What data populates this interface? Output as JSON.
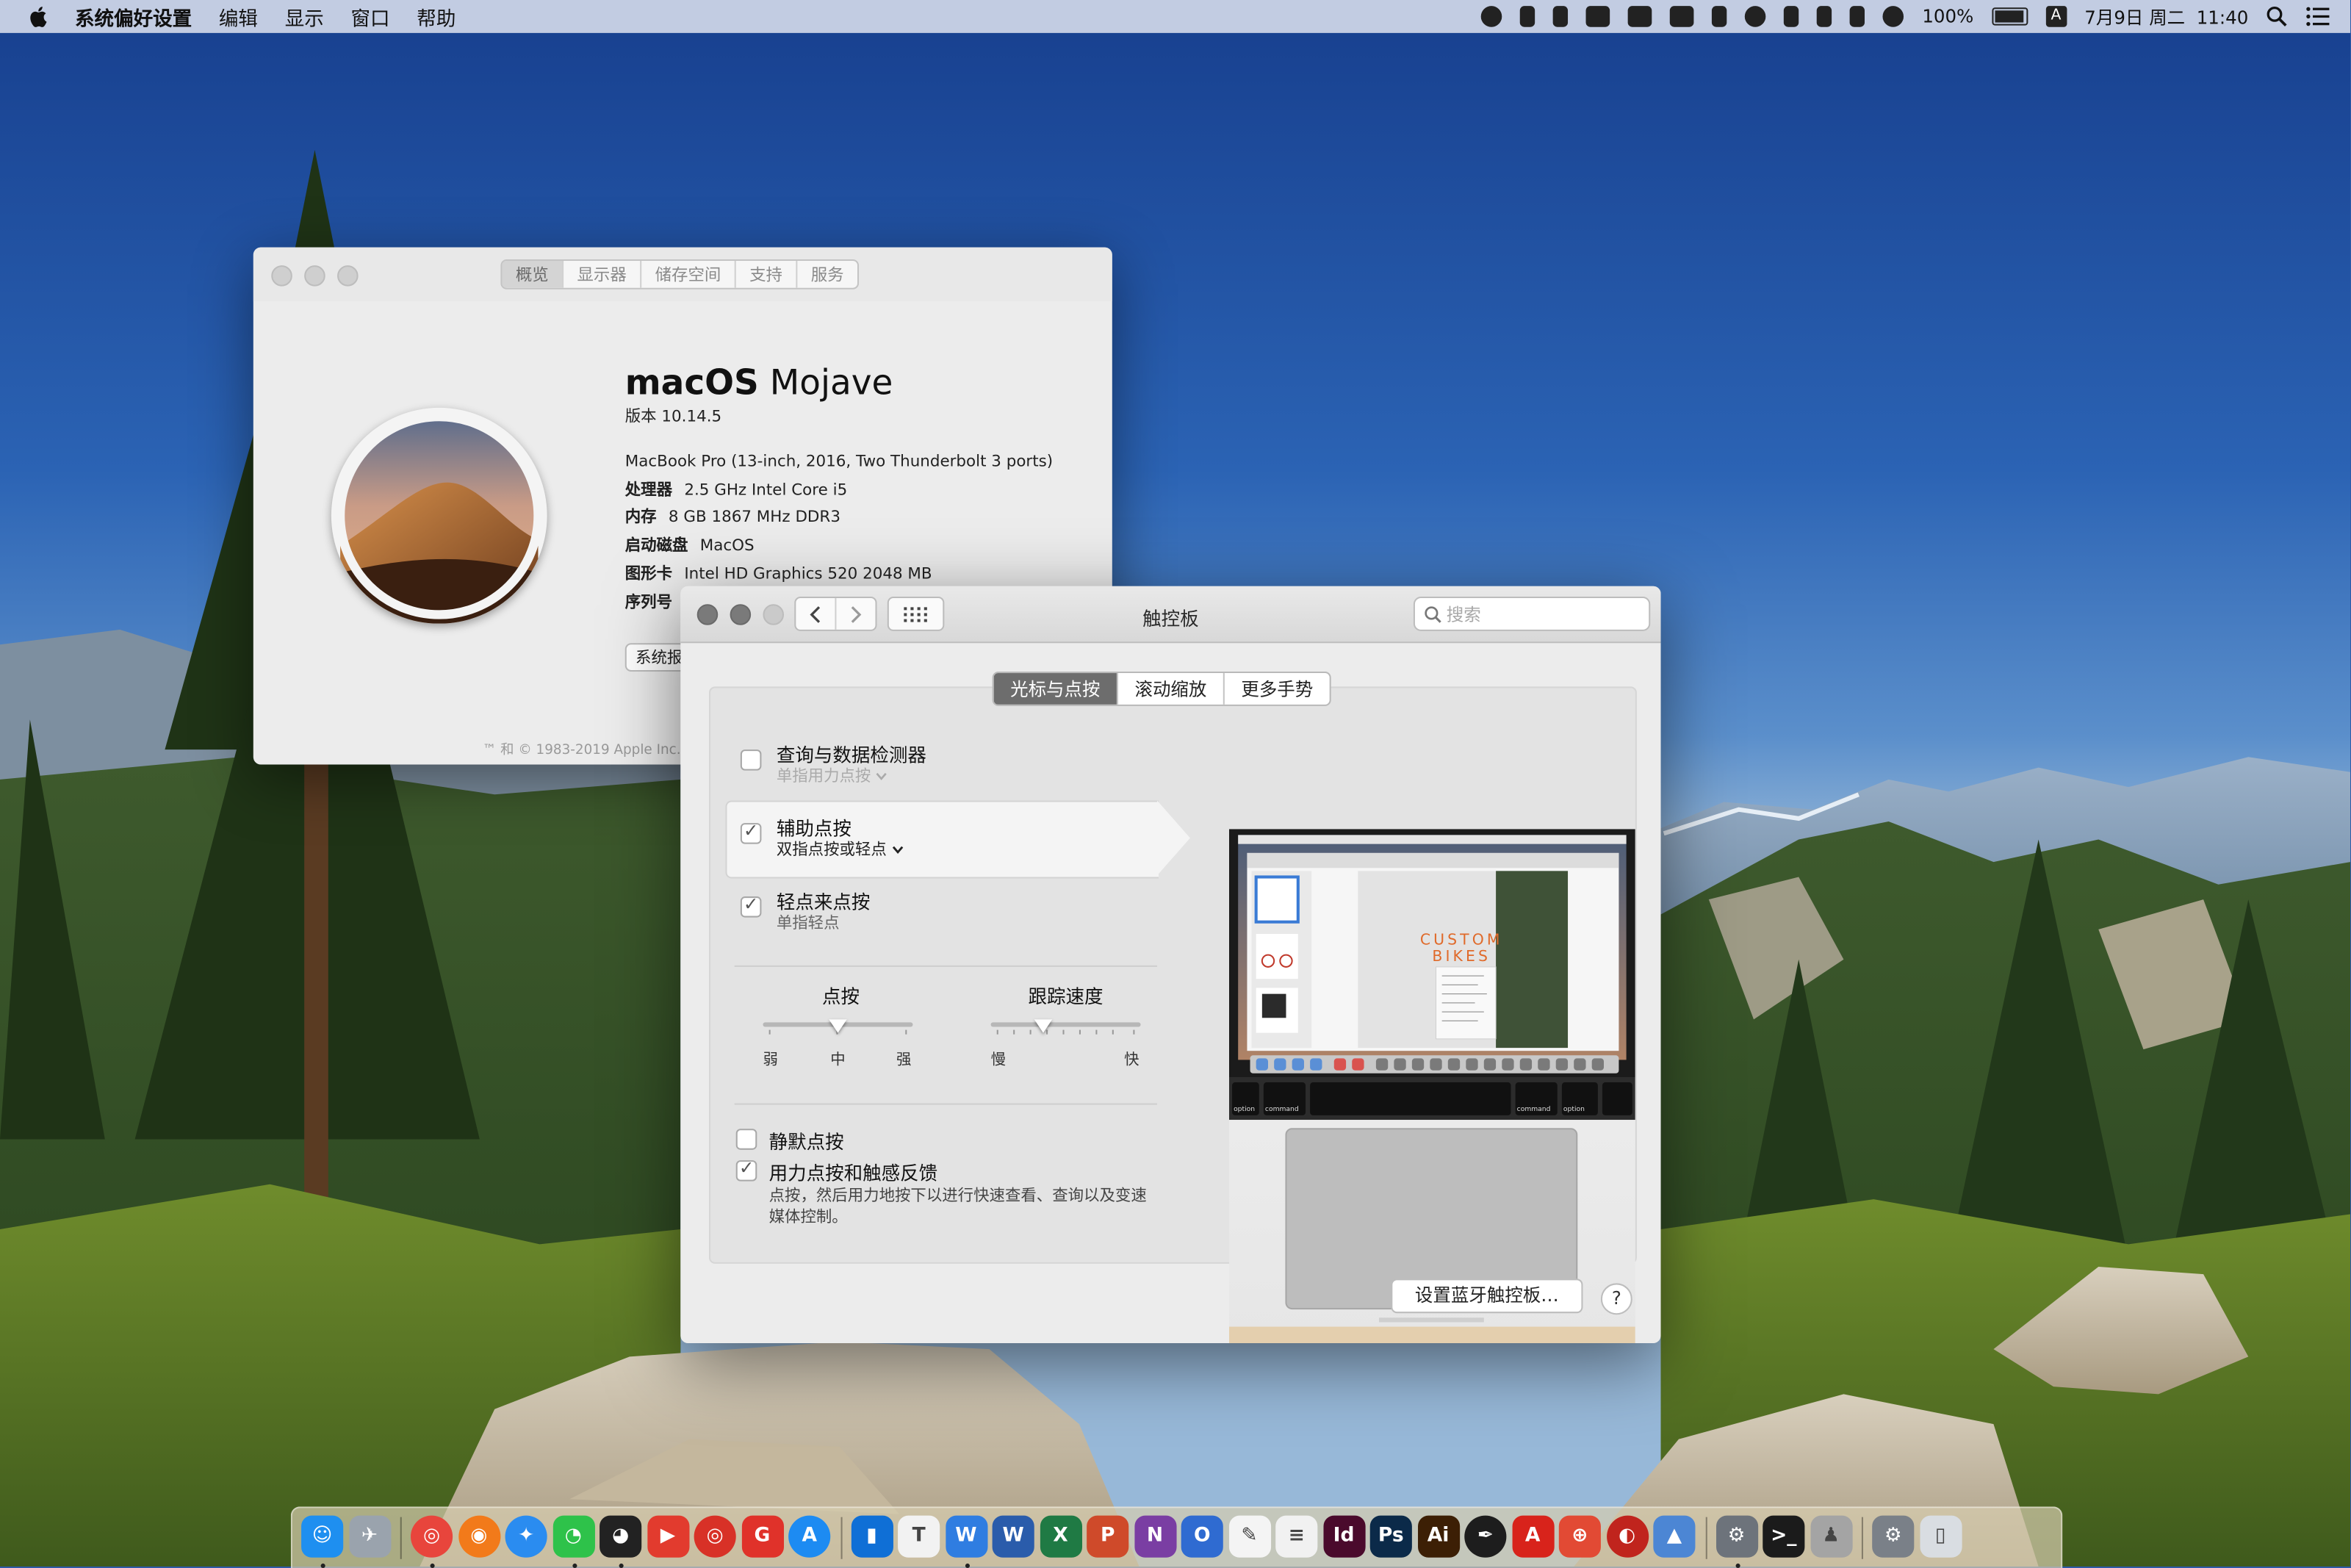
{
  "menubar": {
    "app_name": "系统偏好设置",
    "items": [
      "编辑",
      "显示",
      "窗口",
      "帮助"
    ],
    "battery": "100%",
    "input_method": "A",
    "clock": "7月9日 周二  11:40",
    "status_icons": [
      "wechat-icon",
      "signal-icon",
      "paw-icon",
      "bridge-icon",
      "send-icon",
      "cloud-icon",
      "grid-icon",
      "timemachine-icon",
      "network-icon",
      "eject-icon",
      "volume-icon",
      "vpn-icon"
    ]
  },
  "about": {
    "tabs": [
      "概览",
      "显示器",
      "储存空间",
      "支持",
      "服务"
    ],
    "active_tab": 0,
    "os_name_bold": "macOS",
    "os_name_rest": " Mojave",
    "version": "版本 10.14.5",
    "model": "MacBook Pro (13-inch, 2016, Two Thunderbolt 3 ports)",
    "specs": [
      {
        "key": "处理器",
        "value": "2.5 GHz Intel Core i5"
      },
      {
        "key": "内存",
        "value": "8 GB 1867 MHz DDR3"
      },
      {
        "key": "启动磁盘",
        "value": "MacOS"
      },
      {
        "key": "图形卡",
        "value": "Intel HD Graphics 520 2048 MB"
      },
      {
        "key": "序列号",
        "value": ""
      }
    ],
    "report_button": "系统报告...",
    "copyright": "™ 和 © 1983-2019 Apple Inc."
  },
  "trackpad": {
    "title": "触控板",
    "search_placeholder": "搜索",
    "tabs": [
      "光标与点按",
      "滚动缩放",
      "更多手势"
    ],
    "active_tab": 0,
    "options": [
      {
        "title": "查询与数据检测器",
        "subtitle": "单指用力点按",
        "checked": false,
        "dim": true
      },
      {
        "title": "辅助点按",
        "subtitle": "双指点按或轻点",
        "checked": true,
        "dim": false
      },
      {
        "title": "轻点来点按",
        "subtitle": "单指轻点",
        "checked": true,
        "dim": false
      }
    ],
    "click_slider": {
      "label": "点按",
      "min_label": "弱",
      "mid_label": "中",
      "max_label": "强",
      "value": 0.5
    },
    "speed_slider": {
      "label": "跟踪速度",
      "min_label": "慢",
      "max_label": "快",
      "value": 0.35
    },
    "silent_click": {
      "label": "静默点按",
      "checked": false
    },
    "force_click": {
      "label": "用力点按和触感反馈",
      "checked": true,
      "description": "点按，然后用力地按下以进行快速查看、查询以及变速媒体控制。"
    },
    "preview": {
      "poster_text_1": "CUSTOM",
      "poster_text_2": "BIKES",
      "key_left": "command",
      "key_right": "command",
      "key_option": "option"
    },
    "bluetooth_button": "设置蓝牙触控板…",
    "help_button": "?"
  },
  "dock": {
    "icons": [
      {
        "name": "finder",
        "glyph": "☺",
        "color": "#1e8ff0",
        "running": true
      },
      {
        "name": "launchpad",
        "glyph": "✈",
        "color": "#9aa3ad",
        "running": false
      },
      {
        "name": "sep1",
        "sep": true
      },
      {
        "name": "chrome",
        "glyph": "◎",
        "color": "#e8453c",
        "round": true,
        "running": true
      },
      {
        "name": "firefox",
        "glyph": "◉",
        "color": "#f27a1a",
        "round": true,
        "running": false
      },
      {
        "name": "safari",
        "glyph": "✦",
        "color": "#2a8cf0",
        "round": true,
        "running": false
      },
      {
        "name": "wechat",
        "glyph": "◔",
        "color": "#2ec24a",
        "running": true
      },
      {
        "name": "qq",
        "glyph": "◕",
        "color": "#222222",
        "running": true
      },
      {
        "name": "pdf-expert",
        "glyph": "▶",
        "color": "#e23b2e",
        "running": false
      },
      {
        "name": "netease-music",
        "glyph": "◎",
        "color": "#d83127",
        "round": true,
        "running": false
      },
      {
        "name": "gif-brewery",
        "glyph": "G",
        "color": "#e0322a",
        "running": false
      },
      {
        "name": "app-store",
        "glyph": "A",
        "color": "#1d8bf2",
        "round": true,
        "running": false
      },
      {
        "name": "sep2",
        "sep": true
      },
      {
        "name": "trello",
        "glyph": "▮",
        "color": "#0f6fd6",
        "running": false
      },
      {
        "name": "typora",
        "glyph": "T",
        "color": "#f2f2f2",
        "running": false
      },
      {
        "name": "wps",
        "glyph": "W",
        "color": "#2f7de1",
        "running": true
      },
      {
        "name": "word",
        "glyph": "W",
        "color": "#2a5cab",
        "running": false
      },
      {
        "name": "excel",
        "glyph": "X",
        "color": "#1f7a44",
        "running": false
      },
      {
        "name": "powerpoint",
        "glyph": "P",
        "color": "#cf4a2a",
        "running": false
      },
      {
        "name": "onenote",
        "glyph": "N",
        "color": "#7a3ea3",
        "running": false
      },
      {
        "name": "outlook",
        "glyph": "O",
        "color": "#2f6bd1",
        "running": false
      },
      {
        "name": "pages",
        "glyph": "✎",
        "color": "#f4f4f4",
        "running": false
      },
      {
        "name": "notes",
        "glyph": "≡",
        "color": "#f1f1f1",
        "running": false
      },
      {
        "name": "indesign",
        "glyph": "Id",
        "color": "#4a0a2c",
        "running": false
      },
      {
        "name": "photoshop",
        "glyph": "Ps",
        "color": "#0b2a49",
        "running": false
      },
      {
        "name": "illustrator",
        "glyph": "Ai",
        "color": "#3c1f05",
        "running": false
      },
      {
        "name": "inkscape",
        "glyph": "✒",
        "color": "#1d1d1d",
        "round": true,
        "running": false
      },
      {
        "name": "acrobat",
        "glyph": "A",
        "color": "#d8231b",
        "running": false
      },
      {
        "name": "pdf-reader",
        "glyph": "⊕",
        "color": "#e24a34",
        "running": false
      },
      {
        "name": "recorder",
        "glyph": "◐",
        "color": "#c0241d",
        "round": true,
        "running": false
      },
      {
        "name": "transmit",
        "glyph": "▲",
        "color": "#4c86d4",
        "running": false
      },
      {
        "name": "sep3",
        "sep": true
      },
      {
        "name": "system-preferences",
        "glyph": "⚙",
        "color": "#6d737b",
        "running": true
      },
      {
        "name": "terminal",
        "glyph": ">_",
        "color": "#1b1b1b",
        "running": false
      },
      {
        "name": "automator",
        "glyph": "♟",
        "color": "#a4a4a4",
        "running": false
      },
      {
        "name": "sep4",
        "sep": true
      },
      {
        "name": "system-prefs-2",
        "glyph": "⚙",
        "color": "#7a8088",
        "running": false
      },
      {
        "name": "trash",
        "glyph": "▯",
        "color": "#d9dde2",
        "running": false
      }
    ]
  }
}
